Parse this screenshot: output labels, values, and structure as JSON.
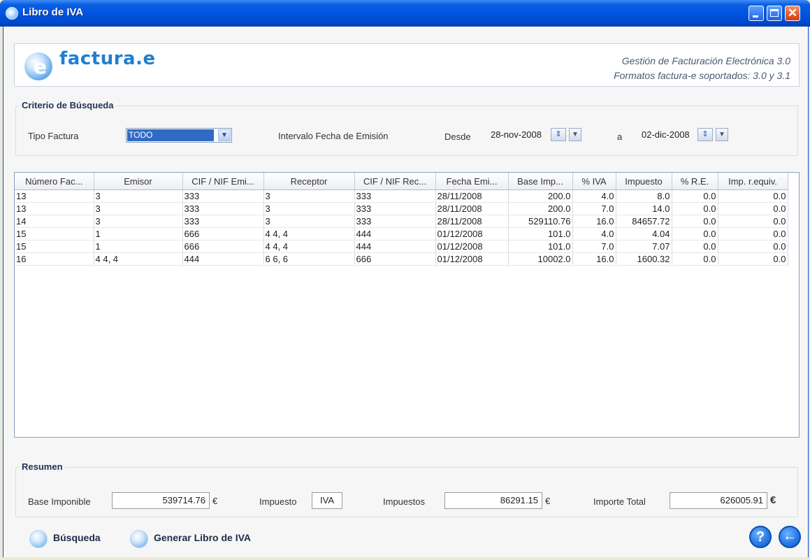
{
  "window": {
    "title": "Libro de IVA"
  },
  "banner": {
    "logo_text": "factura.",
    "logo_e": "e",
    "logo_icon": "e",
    "line1": "Gestión de Facturación Electrónica 3.0",
    "line2": "Formatos factura-e soportados: 3.0 y 3.1"
  },
  "search": {
    "title": "Criterio de Búsqueda",
    "tipo_label": "Tipo Factura",
    "tipo_value": "TODO",
    "intervalo_label": "Intervalo Fecha de Emisión",
    "desde_label": "Desde",
    "desde_value": "28-nov-2008",
    "a_label": "a",
    "hasta_value": "02-dic-2008"
  },
  "table": {
    "columns": [
      "Número Fac...",
      "Emisor",
      "CIF / NIF Emi...",
      "Receptor",
      "CIF / NIF Rec...",
      "Fecha Emi...",
      "Base Imp...",
      "% IVA",
      "Impuesto",
      "% R.E.",
      "Imp. r.equiv."
    ],
    "rows": [
      [
        "13",
        "3",
        "333",
        "3",
        "333",
        "28/11/2008",
        "200.0",
        "4.0",
        "8.0",
        "0.0",
        "0.0"
      ],
      [
        "13",
        "3",
        "333",
        "3",
        "333",
        "28/11/2008",
        "200.0",
        "7.0",
        "14.0",
        "0.0",
        "0.0"
      ],
      [
        "14",
        "3",
        "333",
        "3",
        "333",
        "28/11/2008",
        "529110.76",
        "16.0",
        "84657.72",
        "0.0",
        "0.0"
      ],
      [
        "15",
        "1",
        "666",
        "4 4, 4",
        "444",
        "01/12/2008",
        "101.0",
        "4.0",
        "4.04",
        "0.0",
        "0.0"
      ],
      [
        "15",
        "1",
        "666",
        "4 4, 4",
        "444",
        "01/12/2008",
        "101.0",
        "7.0",
        "7.07",
        "0.0",
        "0.0"
      ],
      [
        "16",
        "4 4, 4",
        "444",
        "6 6, 6",
        "666",
        "01/12/2008",
        "10002.0",
        "16.0",
        "1600.32",
        "0.0",
        "0.0"
      ]
    ]
  },
  "resumen": {
    "title": "Resumen",
    "base_label": "Base Imponible",
    "base_value": "539714.76",
    "euro": "€",
    "impuesto_label": "Impuesto",
    "impuesto_value": "IVA",
    "impuestos_label": "Impuestos",
    "impuestos_value": "86291.15",
    "total_label": "Importe Total",
    "total_value": "626005.91"
  },
  "actions": {
    "busqueda": "Búsqueda",
    "generar": "Generar Libro de IVA",
    "help_glyph": "?",
    "back_glyph": "←"
  },
  "icons": {
    "app": "app-icon",
    "help": "help-icon",
    "back": "back-arrow-icon"
  },
  "colors": {
    "title_bar": "#0054e3",
    "accent": "#1f7fd0",
    "selection": "#316ac5"
  }
}
